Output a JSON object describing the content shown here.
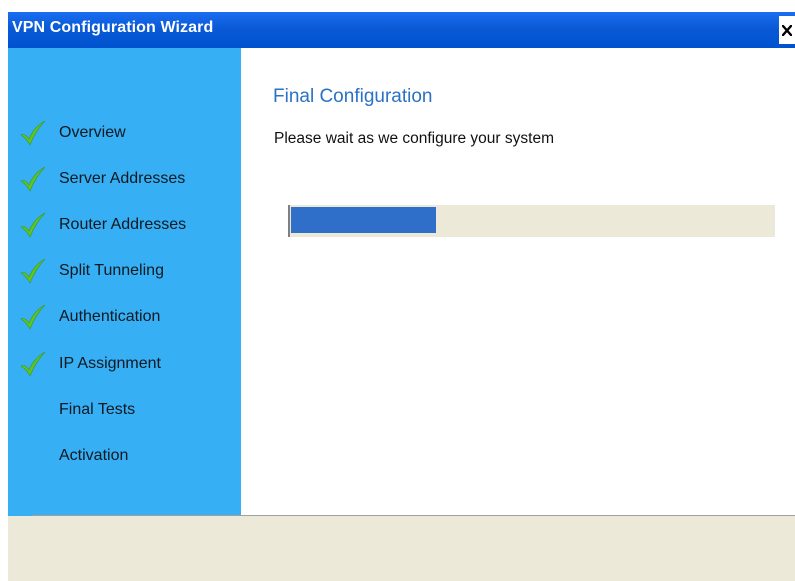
{
  "window": {
    "title": "VPN Configuration Wizard",
    "close_icon": "close-icon"
  },
  "sidebar": {
    "background": "#36aff4",
    "steps": [
      {
        "label": "Overview",
        "completed": true
      },
      {
        "label": "Server Addresses",
        "completed": true
      },
      {
        "label": "Router Addresses",
        "completed": true
      },
      {
        "label": "Split Tunneling",
        "completed": true
      },
      {
        "label": "Authentication",
        "completed": true
      },
      {
        "label": "IP Assignment",
        "completed": true
      },
      {
        "label": "Final Tests",
        "completed": false
      },
      {
        "label": "Activation",
        "completed": false
      }
    ]
  },
  "main": {
    "title": "Final Configuration",
    "description": "Please wait as we configure your system",
    "progress": {
      "fraction": 0.3,
      "fill_color": "#2f6fca"
    }
  },
  "colors": {
    "titlebar": "#0a5ad6",
    "heading": "#2a72c6",
    "footer": "#ece9d8"
  }
}
